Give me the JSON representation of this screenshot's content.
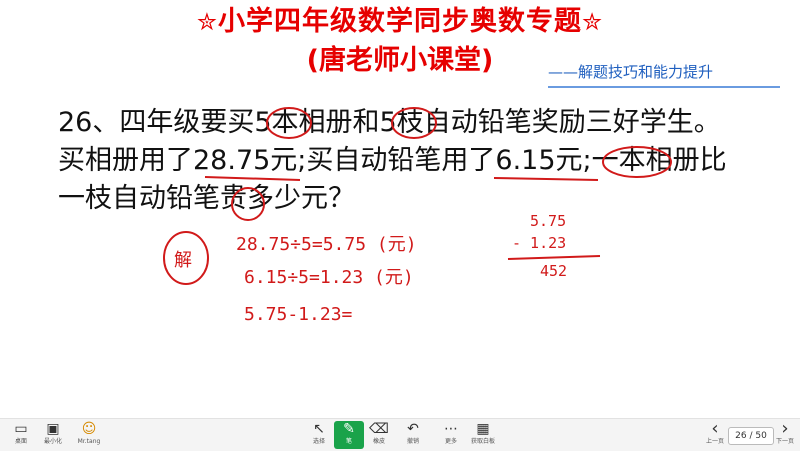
{
  "header": {
    "title_line1": "小学四年级数学同步奥数专题",
    "star_left": "✮",
    "star_right": "✮",
    "title_line2": "(唐老师小课堂)",
    "subtitle": "——解题技巧和能力提升"
  },
  "problem": {
    "line1": "26、四年级要买5本相册和5枝自动铅笔奖励三好学生。",
    "line2": "买相册用了28.75元;买自动铅笔用了6.15元;一本相册比",
    "line3": "一枝自动铅笔贵多少元？"
  },
  "handwriting": {
    "answer_mark": "解",
    "step1": "28.75÷5=5.75 (元)",
    "step2": "6.15÷5=1.23 (元)",
    "step3": "5.75-1.23=",
    "vertical_top": "5.75",
    "vertical_sub": "- 1.23",
    "vertical_result": "452"
  },
  "toolbar_left": [
    {
      "icon": "screen-icon",
      "glyph": "▭",
      "label": "桌面"
    },
    {
      "icon": "minimize-icon",
      "glyph": "▣",
      "label": "最小化"
    },
    {
      "icon": "avatar-icon",
      "glyph": "☺",
      "label": "Mr.tang"
    }
  ],
  "toolbar_center": [
    {
      "icon": "select-icon",
      "glyph": "↖",
      "label": "选择"
    },
    {
      "icon": "pen-icon",
      "glyph": "✎",
      "label": "笔"
    },
    {
      "icon": "eraser-icon",
      "glyph": "⌫",
      "label": "橡皮"
    },
    {
      "icon": "undo-icon",
      "glyph": "↶",
      "label": "撤销"
    },
    {
      "icon": "more-icon",
      "glyph": "⋯",
      "label": "更多"
    },
    {
      "icon": "whiteboard-icon",
      "glyph": "▦",
      "label": "获取白板"
    }
  ],
  "toolbar_right": {
    "prev_label": "上一页",
    "next_label": "下一页",
    "page_indicator": "26 / 50",
    "prev_glyph": "‹",
    "next_glyph": "›"
  },
  "colors": {
    "title": "#e60000",
    "subtitle": "#1f5fbf",
    "ink": "#d11a1a",
    "pen_active": "#1aa34a"
  }
}
